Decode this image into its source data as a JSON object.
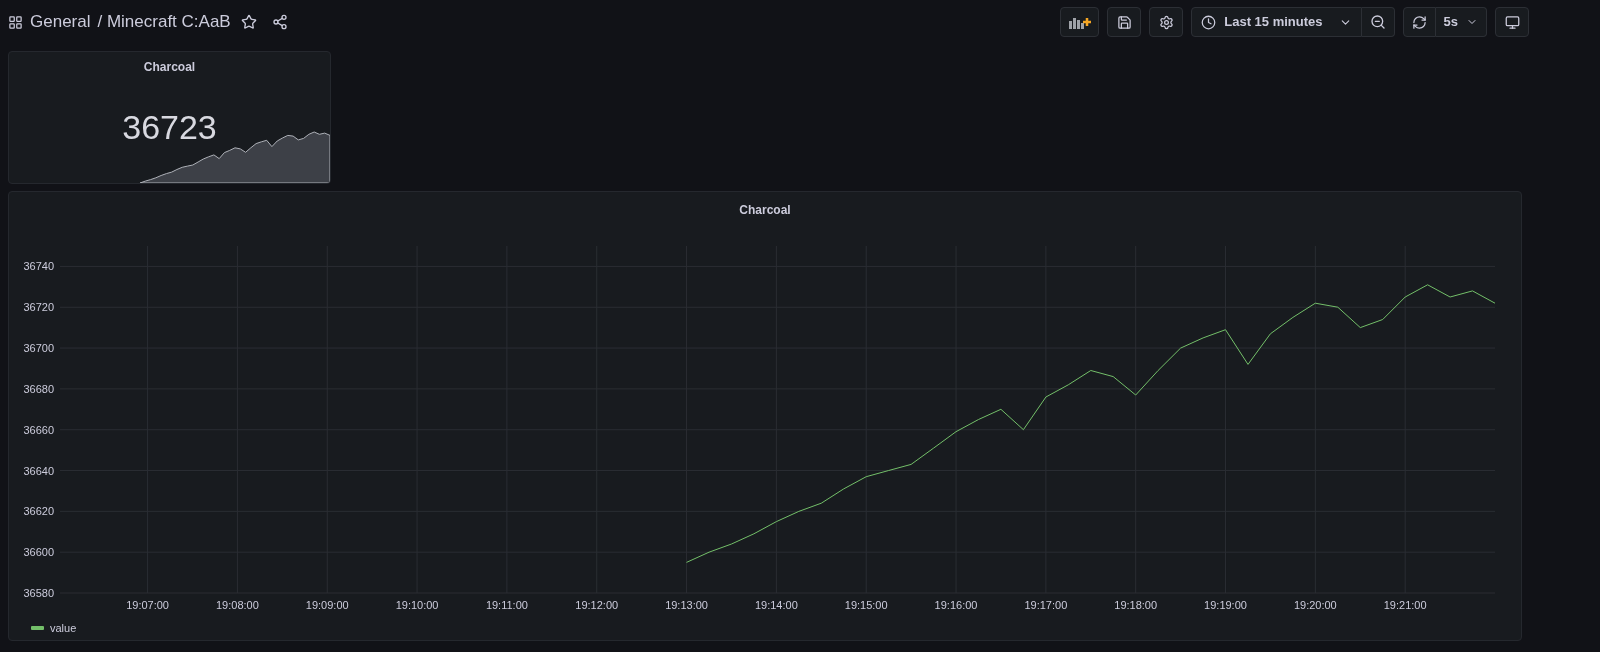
{
  "breadcrumb": {
    "folder": "General",
    "dashboard": "/ Minecraft C:AaB",
    "starred": false
  },
  "toolbar": {
    "time_range": "Last 15 minutes",
    "refresh_interval": "5s"
  },
  "stat_panel": {
    "title": "Charcoal",
    "value": "36723"
  },
  "graph_panel": {
    "title": "Charcoal",
    "chart_data": {
      "type": "line",
      "categories": [
        "19:07:00",
        null,
        null,
        null,
        "19:08:00",
        null,
        null,
        null,
        "19:09:00",
        null,
        null,
        null,
        "19:10:00",
        null,
        null,
        null,
        "19:11:00",
        null,
        null,
        null,
        "19:12:00",
        null,
        null,
        null,
        "19:13:00",
        null,
        null,
        null,
        "19:14:00",
        null,
        null,
        null,
        "19:15:00",
        null,
        null,
        null,
        "19:16:00",
        null,
        null,
        null,
        "19:17:00",
        null,
        null,
        null,
        "19:18:00",
        null,
        null,
        null,
        "19:19:00",
        null,
        null,
        null,
        "19:20:00",
        null,
        null,
        null,
        "19:21:00",
        null,
        null,
        null,
        null
      ],
      "series": [
        {
          "name": "value",
          "color": "#73bf69",
          "values": [
            null,
            null,
            null,
            null,
            null,
            null,
            null,
            null,
            null,
            null,
            null,
            null,
            null,
            null,
            null,
            null,
            null,
            null,
            null,
            null,
            null,
            null,
            null,
            null,
            36595,
            36600,
            36604,
            36609,
            36615,
            36620,
            36624,
            36631,
            36637,
            36640,
            36643,
            36651,
            36659,
            36665,
            36670,
            36660,
            36676,
            36682,
            36689,
            36686,
            36677,
            36689,
            36700,
            36705,
            36709,
            36692,
            36707,
            36715,
            36722,
            36720,
            36710,
            36714,
            36725,
            36731,
            36725,
            36728,
            36722
          ]
        }
      ],
      "grid": true,
      "ylim": [
        36580,
        36750
      ],
      "yticks": [
        36580,
        36600,
        36620,
        36640,
        36660,
        36680,
        36700,
        36720,
        36740
      ]
    }
  }
}
